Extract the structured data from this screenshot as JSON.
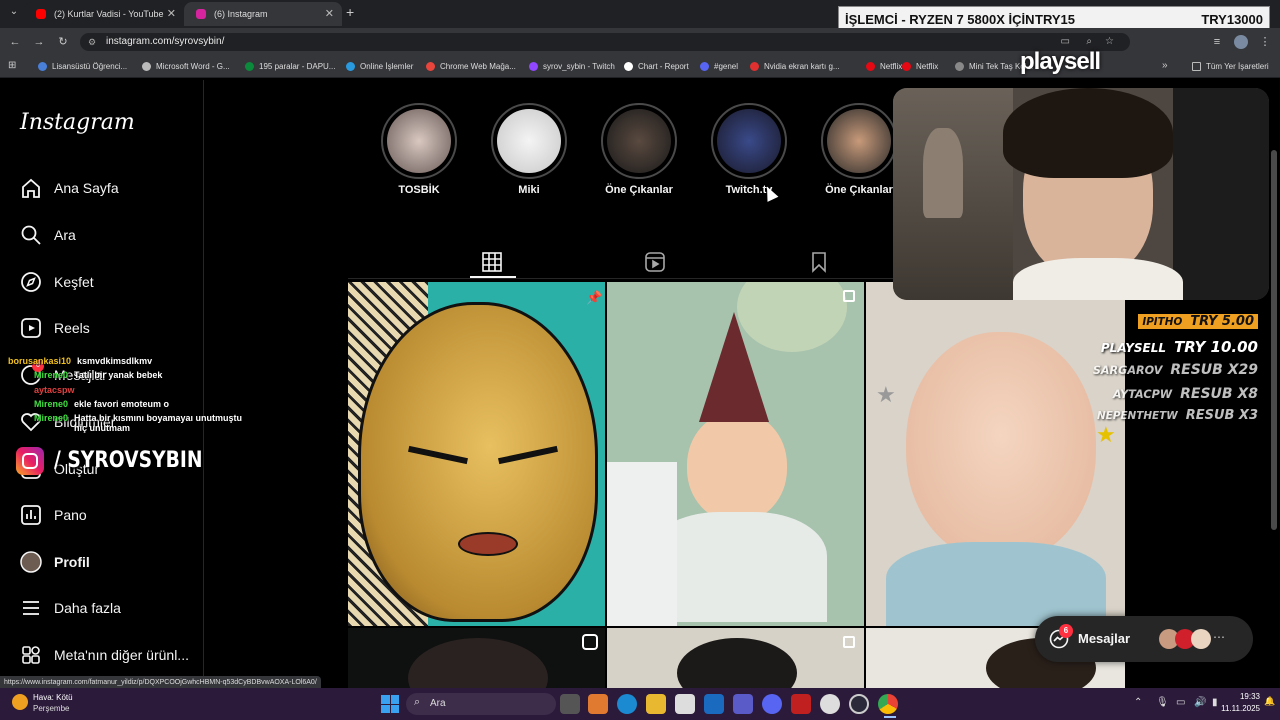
{
  "browser": {
    "tabs": [
      {
        "title": "(2) Kurtlar Vadisi - YouTube",
        "icon_color": "#ff0000"
      },
      {
        "title": "(6) Instagram",
        "icon_color": "#d6249f"
      }
    ],
    "new_tab": "+",
    "url": "instagram.com/syrovsybin/",
    "bookmarks": [
      {
        "label": "Lisansüstü Öğrenci...",
        "color": "#4a7fd8"
      },
      {
        "label": "Microsoft Word - G...",
        "color": "#bbbbbb"
      },
      {
        "label": "195 paralar - DAPU...",
        "color": "#0a8a3a"
      },
      {
        "label": "Online İşlemler",
        "color": "#2a9adf"
      },
      {
        "label": "Chrome Web Mağa...",
        "color": "#e8453c"
      },
      {
        "label": "syrov_sybin - Twitch",
        "color": "#9146ff"
      },
      {
        "label": "Chart - Report",
        "color": "#ffffff"
      },
      {
        "label": "#genel",
        "color": "#5865f2"
      },
      {
        "label": "Nvidia ekran kartı g...",
        "color": "#e03030"
      },
      {
        "label": "Netflix",
        "color": "#e50914"
      },
      {
        "label": "Netflix",
        "color": "#e50914"
      },
      {
        "label": "Mini Tek Taş Kol...",
        "color": "#888888"
      }
    ],
    "all_bookmarks": "Tüm Yer İşaretleri",
    "status_url": "https://www.instagram.com/fatmanur_yildiz/p/DQXPCOOjGwhcHBMN-q53dCyBDBvwAOXA-LOl6A0/"
  },
  "banner": {
    "left": "İŞLEMCİ - RYZEN 7 5800X İÇİN",
    "mid": "TRY15",
    "right": "TRY13000"
  },
  "playsell_logo": "playsell",
  "instagram": {
    "logo": "Instagram",
    "nav": [
      {
        "label": "Ana Sayfa",
        "icon": "home-icon"
      },
      {
        "label": "Ara",
        "icon": "search-icon"
      },
      {
        "label": "Keşfet",
        "icon": "compass-icon"
      },
      {
        "label": "Reels",
        "icon": "reels-icon"
      },
      {
        "label": "Mesajlar",
        "icon": "messenger-icon",
        "badge": "6"
      },
      {
        "label": "Bildirimler",
        "icon": "heart-icon"
      },
      {
        "label": "Oluştur",
        "icon": "plus-icon"
      },
      {
        "label": "Pano",
        "icon": "chart-icon"
      },
      {
        "label": "Profil",
        "icon": "avatar-icon"
      },
      {
        "label": "Daha fazla",
        "icon": "menu-icon"
      },
      {
        "label": "Meta'nın diğer ürünl...",
        "icon": "meta-apps-icon"
      }
    ],
    "stories": [
      {
        "label": "TOSBİK"
      },
      {
        "label": "Miki"
      },
      {
        "label": "Öne Çıkanlar"
      },
      {
        "label": "Twitch.tv"
      },
      {
        "label": "Öne Çıkanlar"
      }
    ],
    "messages_label": "Mesajlar",
    "messages_badge": "6"
  },
  "stream_overlay": {
    "handle": "/ SYROVSYBIN",
    "chat": [
      {
        "user": "borusankasi10",
        "user_color": "#f0c020",
        "text": "ksmvdkimsdlkmv"
      },
      {
        "user": "Mirene0",
        "user_color": "#40e040",
        "text": "Tatlı bir yanak bebek"
      },
      {
        "user": "aytacspw",
        "user_color": "#e04040",
        "text": ""
      },
      {
        "user": "Mirene0",
        "user_color": "#40e040",
        "text": "ekle favori emoteum o"
      },
      {
        "user": "Mirene0",
        "user_color": "#40e040",
        "text": "Hatta bir kısmını boyamayaı unutmuştu hiç unutmam"
      }
    ],
    "donations": [
      {
        "name": "IPITHO",
        "amount": "TRY 5.00"
      },
      {
        "name": "PLAYSELL",
        "amount": "TRY 10.00"
      },
      {
        "name": "SARGAROV",
        "amount": "RESUB X29"
      },
      {
        "name": "AYTACPW",
        "amount": "RESUB X8"
      },
      {
        "name": "NEPENTHETW",
        "amount": "RESUB X3"
      }
    ]
  },
  "taskbar": {
    "weather": "Hava: Kötü",
    "weather_sub": "Perşembe",
    "search": "Ara",
    "time": "19:33",
    "date": "11.11.2025"
  }
}
